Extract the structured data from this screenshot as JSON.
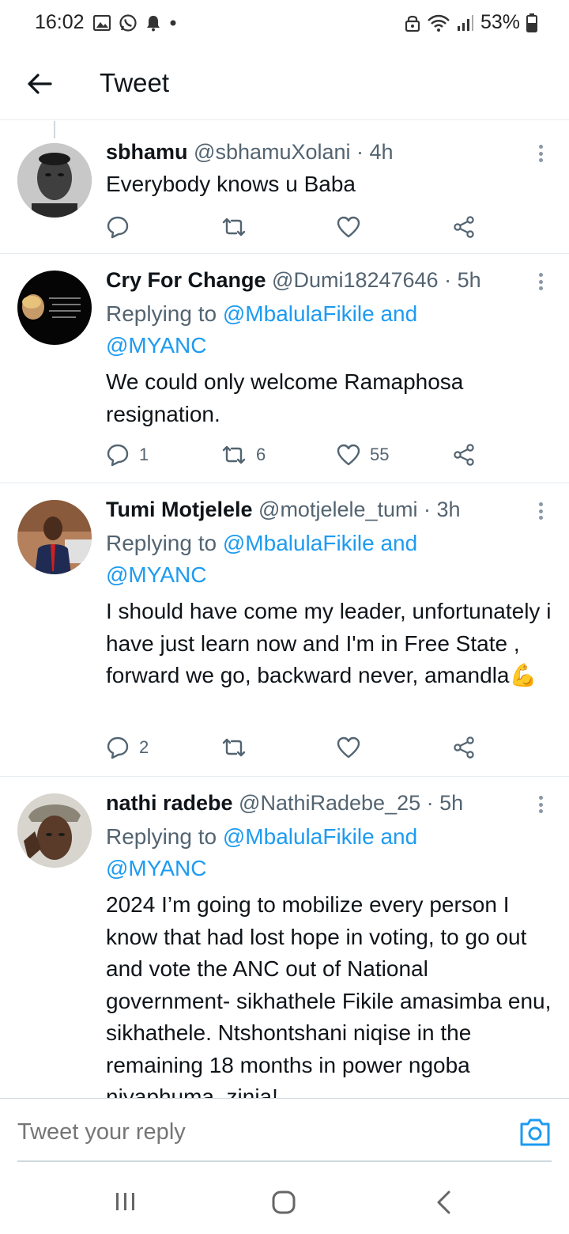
{
  "status_bar": {
    "time": "16:02",
    "battery": "53%"
  },
  "header": {
    "title": "Tweet"
  },
  "tweets": [
    {
      "name": "sbhamu",
      "meta": " @sbhamuXolani · 4h",
      "reply_prefix": "",
      "reply_mention_1": "",
      "reply_mention_2": "",
      "text": "Everybody knows u Baba",
      "replies": "",
      "retweets": "",
      "likes": ""
    },
    {
      "name": "Cry For Change",
      "meta": " @Dumi18247646 · 5h",
      "reply_prefix": "Replying to ",
      "reply_mention_1": "@MbalulaFikile and",
      "reply_mention_2": "@MYANC",
      "text": "We could only welcome Ramaphosa resignation.",
      "replies": "1",
      "retweets": "6",
      "likes": "55"
    },
    {
      "name": "Tumi Motjelele",
      "meta": " @motjelele_tumi · 3h",
      "reply_prefix": "Replying to ",
      "reply_mention_1": "@MbalulaFikile and",
      "reply_mention_2": "@MYANC",
      "text": "I  should have come my leader, unfortunately i have just learn now and I'm in Free State , forward we go, backward never, amandla💪",
      "replies": "2",
      "retweets": "",
      "likes": ""
    },
    {
      "name": "nathi radebe",
      "meta": " @NathiRadebe_25 · 5h",
      "reply_prefix": "Replying to ",
      "reply_mention_1": "@MbalulaFikile and",
      "reply_mention_2": "@MYANC",
      "text": "2024 I’m going to mobilize every person I know that had lost hope in voting, to go out and vote the ANC out of National government- sikhathele Fikile amasimba enu, sikhathele. Ntshontshani niqise in the remaining 18 months in power ngoba niyaphuma, zinja!",
      "replies": "",
      "retweets": "",
      "likes": ""
    }
  ],
  "reply_bar": {
    "placeholder": "Tweet your reply"
  },
  "icons": {
    "back": "arrow-left-icon",
    "reply": "speech-bubble-icon",
    "retweet": "retweet-icon",
    "like": "heart-icon",
    "share": "share-icon",
    "more": "more-vertical-icon",
    "camera": "camera-icon"
  },
  "colors": {
    "accent": "#1d9bf0",
    "text": "#0f1419",
    "secondary": "#536471"
  }
}
